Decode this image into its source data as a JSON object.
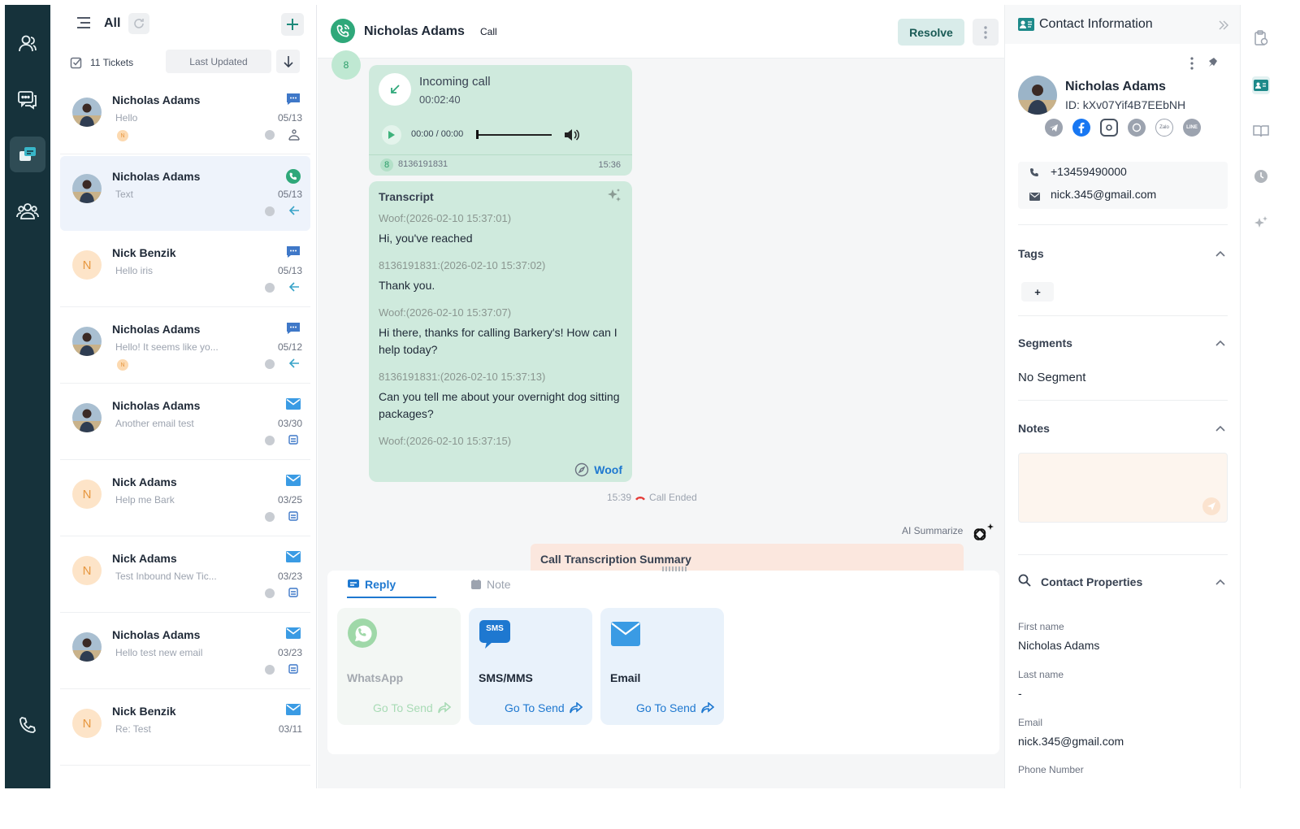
{
  "ticket_list": {
    "filter_label": "All",
    "ticket_count": "11 Tickets",
    "sort_label": "Last Updated",
    "tickets": [
      {
        "name": "Nicholas Adams",
        "preview": "Hello",
        "date": "05/13",
        "channel": "chat",
        "avatar": "photo",
        "mini": "N"
      },
      {
        "name": "Nicholas Adams",
        "preview": "Text",
        "date": "05/13",
        "channel": "call",
        "avatar": "photo"
      },
      {
        "name": "Nick Benzik",
        "preview": "Hello iris",
        "date": "05/13",
        "channel": "chat",
        "avatar": "N"
      },
      {
        "name": "Nicholas Adams",
        "preview": "Hello! It seems like yo...",
        "date": "05/12",
        "channel": "chat",
        "avatar": "photo",
        "mini": "N"
      },
      {
        "name": "Nicholas Adams",
        "preview": "Another email test",
        "date": "03/30",
        "channel": "email",
        "avatar": "photo"
      },
      {
        "name": "Nick Adams",
        "preview": "Help me Bark",
        "date": "03/25",
        "channel": "email",
        "avatar": "N"
      },
      {
        "name": "Nick Adams",
        "preview": "Test Inbound New Tic...",
        "date": "03/23",
        "channel": "email",
        "avatar": "N"
      },
      {
        "name": "Nicholas Adams",
        "preview": "Hello test new email",
        "date": "03/23",
        "channel": "email",
        "avatar": "photo"
      },
      {
        "name": "Nick Benzik",
        "preview": "Re: Test",
        "date": "03/11",
        "channel": "email",
        "avatar": "N"
      }
    ]
  },
  "conversation": {
    "name": "Nicholas Adams",
    "channel_tag": "Call",
    "resolve_label": "Resolve",
    "top_badge": "8",
    "call": {
      "title": "Incoming call",
      "duration": "00:02:40",
      "playback": "00:00 / 00:00",
      "caller_badge": "8",
      "caller_number": "8136191831",
      "time": "15:36"
    },
    "transcript": {
      "title": "Transcript",
      "entries": [
        {
          "speaker": "Woof:(2026-02-10 15:37:01)",
          "text1": "Hi, you've reached",
          "text2": ""
        },
        {
          "speaker": "8136191831:(2026-02-10 15:37:02)",
          "text1": "Thank you.",
          "text2": ""
        },
        {
          "speaker": "Woof:(2026-02-10 15:37:07)",
          "text1": "Hi there, thanks for calling Barkery's! How can I",
          "text2": "help today?"
        },
        {
          "speaker": "8136191831:(2026-02-10 15:37:13)",
          "text1": "Can you tell me about your overnight dog sitting",
          "text2": "packages?"
        },
        {
          "speaker": "Woof:(2026-02-10 15:37:15)",
          "text1": "",
          "text2": ""
        }
      ],
      "agent": "Woof"
    },
    "call_ended_time": "15:39",
    "call_ended_label": "Call Ended",
    "ai_summarize_label": "AI Summarize",
    "summary_title": "Call Transcription Summary"
  },
  "reply_box": {
    "tabs": {
      "reply": "Reply",
      "note": "Note"
    },
    "cards": [
      {
        "label": "WhatsApp",
        "action": "Go To Send"
      },
      {
        "label": "SMS/MMS",
        "action": "Go To Send",
        "icon_text": "SMS"
      },
      {
        "label": "Email",
        "action": "Go To Send"
      }
    ]
  },
  "contact": {
    "panel_title": "Contact Information",
    "name": "Nicholas Adams",
    "id_label": "ID: kXv07Yif4B7EEbNH",
    "phone": "+13459490000",
    "email": "nick.345@gmail.com",
    "social_zalo": "Zalo",
    "social_line": "LINE",
    "tags_title": "Tags",
    "add_tag": "+",
    "segments_title": "Segments",
    "segments_value": "No Segment",
    "notes_title": "Notes",
    "properties_title": "Contact Properties",
    "properties": [
      {
        "label": "First name",
        "value": "Nicholas Adams"
      },
      {
        "label": "Last name",
        "value": "-"
      },
      {
        "label": "Email",
        "value": "nick.345@gmail.com"
      },
      {
        "label": "Phone Number",
        "value": ""
      }
    ]
  },
  "colors": {
    "rail": "#16323b",
    "accent_green": "#28a070",
    "accent_blue": "#1e78d0",
    "bubble": "#cfeadd"
  }
}
